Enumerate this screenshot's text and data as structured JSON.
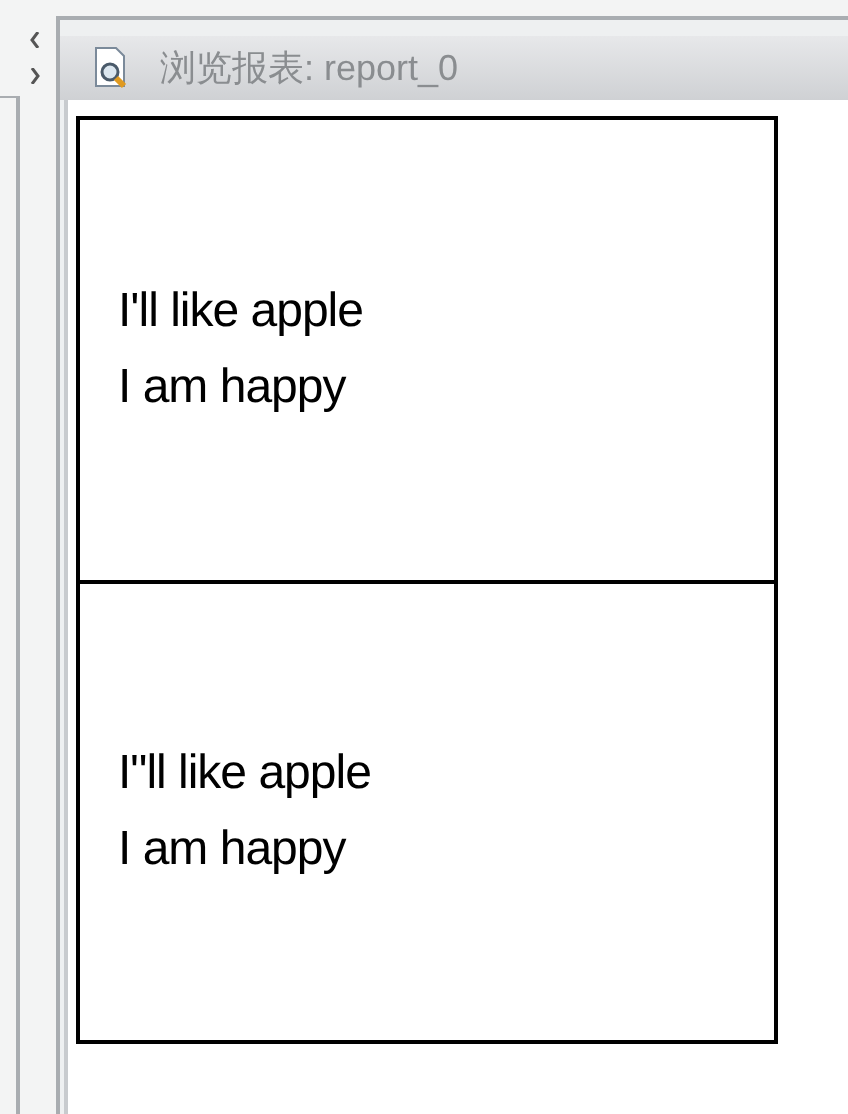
{
  "panel": {
    "title": "浏览报表: report_0"
  },
  "report": {
    "sections": [
      {
        "lines": [
          "I'll like apple",
          "I am happy"
        ]
      },
      {
        "lines": [
          "I\"ll like apple",
          "I am happy"
        ]
      }
    ]
  }
}
